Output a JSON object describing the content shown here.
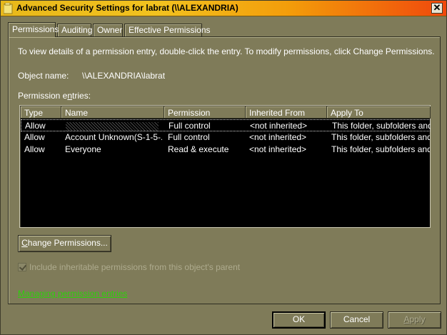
{
  "window": {
    "title": "Advanced Security Settings for labrat (\\\\ALEXANDRIA)",
    "close_glyph": "✕"
  },
  "tabs": [
    {
      "label": "Permissions",
      "active": true
    },
    {
      "label": "Auditing",
      "active": false
    },
    {
      "label": "Owner",
      "active": false
    },
    {
      "label": "Effective Permissions",
      "active": false
    }
  ],
  "permissions_tab": {
    "description": "To view details of a permission entry, double-click the entry. To modify permissions, click Change Permissions.",
    "object_name_label": "Object name:",
    "object_name_value": "\\\\ALEXANDRIA\\labrat",
    "entries_label": "Permission entries:",
    "columns": [
      "Type",
      "Name",
      "Permission",
      "Inherited From",
      "Apply To"
    ],
    "rows": [
      {
        "type": "Allow",
        "name": "",
        "permission": "Full control",
        "inherited_from": "<not inherited>",
        "apply_to": "This folder, subfolders and...",
        "selected": true,
        "name_obscured": true
      },
      {
        "type": "Allow",
        "name": "Account Unknown(S-1-5-...",
        "permission": "Full control",
        "inherited_from": "<not inherited>",
        "apply_to": "This folder, subfolders and...",
        "selected": false
      },
      {
        "type": "Allow",
        "name": "Everyone",
        "permission": "Read & execute",
        "inherited_from": "<not inherited>",
        "apply_to": "This folder, subfolders and...",
        "selected": false
      }
    ],
    "change_button": "Change Permissions...",
    "include_inheritable_label": "Include inheritable permissions from this object's parent",
    "include_inheritable_checked": true,
    "include_inheritable_enabled": false,
    "manage_link": "Managing permission entries"
  },
  "footer": {
    "ok": "OK",
    "cancel": "Cancel",
    "apply": "Apply",
    "apply_enabled": false
  },
  "colors": {
    "titlebar_start": "#e8b81a",
    "titlebar_end": "#f0480c",
    "face": "#7f7b59",
    "list_bg": "#000000",
    "link": "#2cd10a"
  }
}
